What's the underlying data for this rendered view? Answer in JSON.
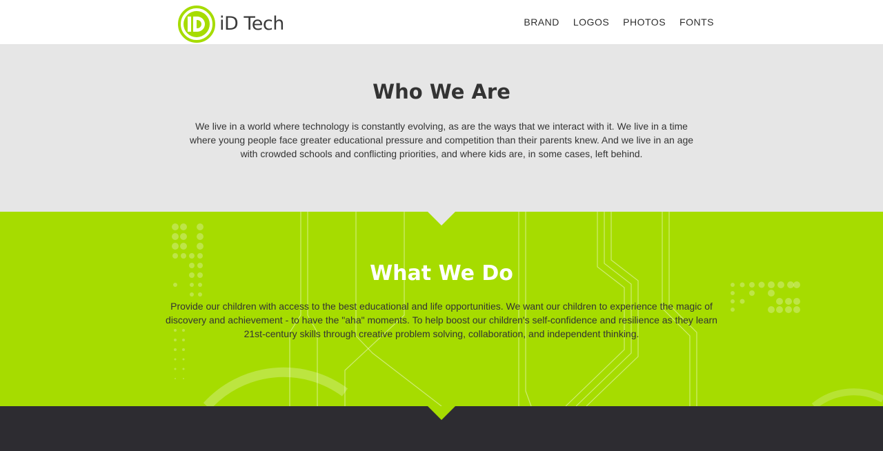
{
  "brand": {
    "name": "iD Tech",
    "badge_letters": "iD",
    "accent_color": "#a6dc00"
  },
  "nav": {
    "items": [
      {
        "label": "BRAND"
      },
      {
        "label": "LOGOS"
      },
      {
        "label": "PHOTOS"
      },
      {
        "label": "FONTS"
      }
    ]
  },
  "who": {
    "title": "Who We Are",
    "body": "We live in a world where technology is constantly evolving, as are the ways that we interact with it. We live in a time where young people face greater educational pressure and competition than their parents knew. And we live in an age with crowded schools and conflicting priorities, and where kids are, in some cases, left behind.",
    "background": "#e6e6e6"
  },
  "what": {
    "title": "What We Do",
    "body": "Provide our children with access to the best educational and life opportunities. We want our children to experience the magic of discovery and achievement - to have the \"aha\" moments. To help boost our children's self-confidence and resilience as they learn 21st-century skills through creative problem solving, collaboration, and independent thinking.",
    "background": "#a6dc00"
  },
  "footer_band": {
    "background": "#2d2c31"
  }
}
